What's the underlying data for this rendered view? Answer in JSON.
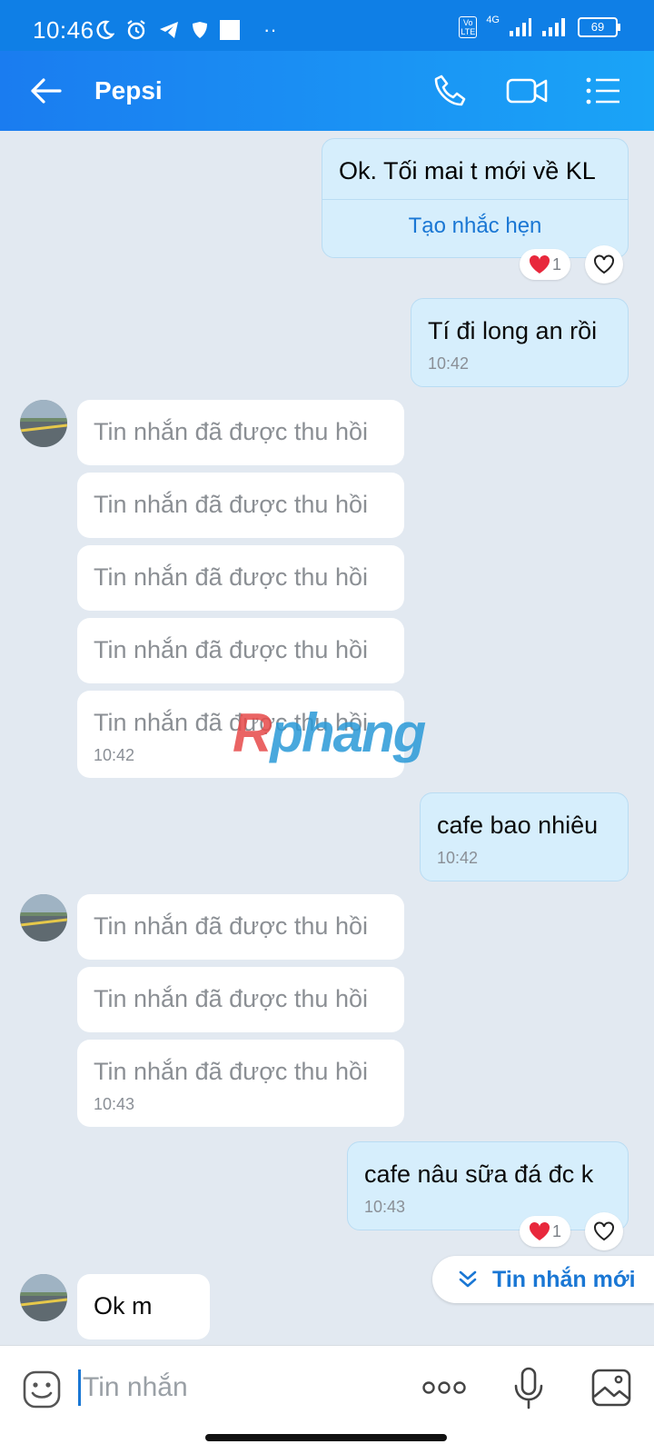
{
  "status_bar": {
    "time": "10:46",
    "network": "4G",
    "volte": "Vo LTE",
    "battery": "69"
  },
  "header": {
    "title": "Pepsi"
  },
  "messages": {
    "m1": {
      "text": "Ok. Tối mai t mới về KL",
      "action": "Tạo nhắc hẹn",
      "reaction_count": "1"
    },
    "m2": {
      "text": "Tí đi long an rồi",
      "time": "10:42"
    },
    "recalled_text": "Tin nhắn đã được thu hồi",
    "recalled_time_1": "10:42",
    "m3": {
      "text": "cafe bao nhiêu",
      "time": "10:42"
    },
    "recalled_time_2": "10:43",
    "m4": {
      "text": "cafe nâu sữa đá đc k",
      "time": "10:43",
      "reaction_count": "1"
    },
    "m5": {
      "text": "Ok m"
    }
  },
  "watermark": {
    "part1": "R",
    "part2": "phang"
  },
  "new_messages_button": "Tin nhắn mới",
  "input": {
    "placeholder": "Tin nhắn"
  },
  "colors": {
    "header_bg": "#1a7cf0",
    "outgoing_bubble": "#d6eefc",
    "incoming_bubble": "#ffffff",
    "accent": "#1a77d4"
  }
}
